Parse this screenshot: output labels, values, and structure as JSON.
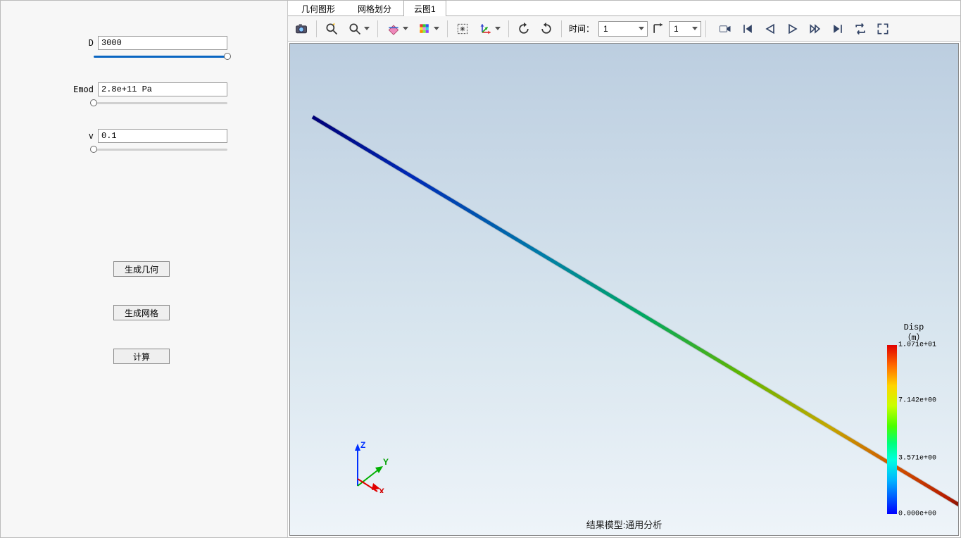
{
  "params": {
    "D": {
      "label": "D",
      "value": "3000",
      "slider_pct": 100
    },
    "Emod": {
      "label": "Emod",
      "value": "2.8e+11 Pa",
      "slider_pct": 0
    },
    "v": {
      "label": "v",
      "value": "0.1",
      "slider_pct": 0
    }
  },
  "buttons": {
    "gen_geom": "生成几何",
    "gen_mesh": "生成网格",
    "compute": "计算"
  },
  "tabs": {
    "geom": "几何图形",
    "mesh": "网格划分",
    "cloud1": "云图1",
    "active": "cloud1"
  },
  "toolbar": {
    "time_label": "时间：",
    "time_value": "1",
    "frame_value": "1"
  },
  "viewport": {
    "caption": "结果模型:通用分析",
    "axes": {
      "x": "X",
      "y": "Y",
      "z": "Z"
    }
  },
  "legend": {
    "title_line1": "Disp",
    "title_line2": "（m）",
    "ticks": [
      {
        "label": "1.071e+01",
        "pct": 0
      },
      {
        "label": "7.142e+00",
        "pct": 33
      },
      {
        "label": "3.571e+00",
        "pct": 67
      },
      {
        "label": "0.000e+00",
        "pct": 100
      }
    ]
  }
}
